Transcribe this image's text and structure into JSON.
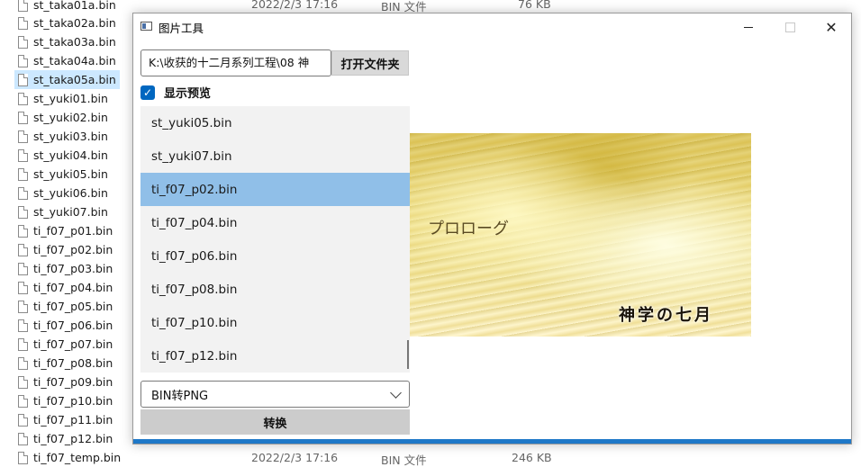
{
  "explorer": {
    "top_row": {
      "name": "st_taka01a.bin",
      "date": "2022/2/3 17:16",
      "type": "BIN 文件",
      "size": "76 KB"
    },
    "files": [
      "st_taka02a.bin",
      "st_taka03a.bin",
      "st_taka04a.bin",
      "st_taka05a.bin",
      "st_yuki01.bin",
      "st_yuki02.bin",
      "st_yuki03.bin",
      "st_yuki04.bin",
      "st_yuki05.bin",
      "st_yuki06.bin",
      "st_yuki07.bin",
      "ti_f07_p01.bin",
      "ti_f07_p02.bin",
      "ti_f07_p03.bin",
      "ti_f07_p04.bin",
      "ti_f07_p05.bin",
      "ti_f07_p06.bin",
      "ti_f07_p07.bin",
      "ti_f07_p08.bin",
      "ti_f07_p09.bin",
      "ti_f07_p10.bin",
      "ti_f07_p11.bin",
      "ti_f07_p12.bin"
    ],
    "selected_file": "st_taka05a.bin",
    "bottom_row": {
      "name": "ti_f07_temp.bin",
      "date": "2022/2/3 17:16",
      "type": "BIN 文件",
      "size": "246 KB"
    }
  },
  "window": {
    "title": "图片工具",
    "icon": "app-window-icon",
    "path_value": "K:\\收获的十二月系列工程\\08 神",
    "open_folder_label": "打开文件夹",
    "show_preview_label": "显示预览",
    "show_preview_checked": true,
    "file_list": [
      "st_yuki05.bin",
      "st_yuki07.bin",
      "ti_f07_p02.bin",
      "ti_f07_p04.bin",
      "ti_f07_p06.bin",
      "ti_f07_p08.bin",
      "ti_f07_p10.bin",
      "ti_f07_p12.bin"
    ],
    "selected_index": 2,
    "convert_mode": "BIN转PNG",
    "convert_label": "转换",
    "preview": {
      "caption": "プロローグ",
      "logo": "神学の七月"
    },
    "accent_color": "#1e78c8",
    "selection_color": "#90bfe8"
  }
}
